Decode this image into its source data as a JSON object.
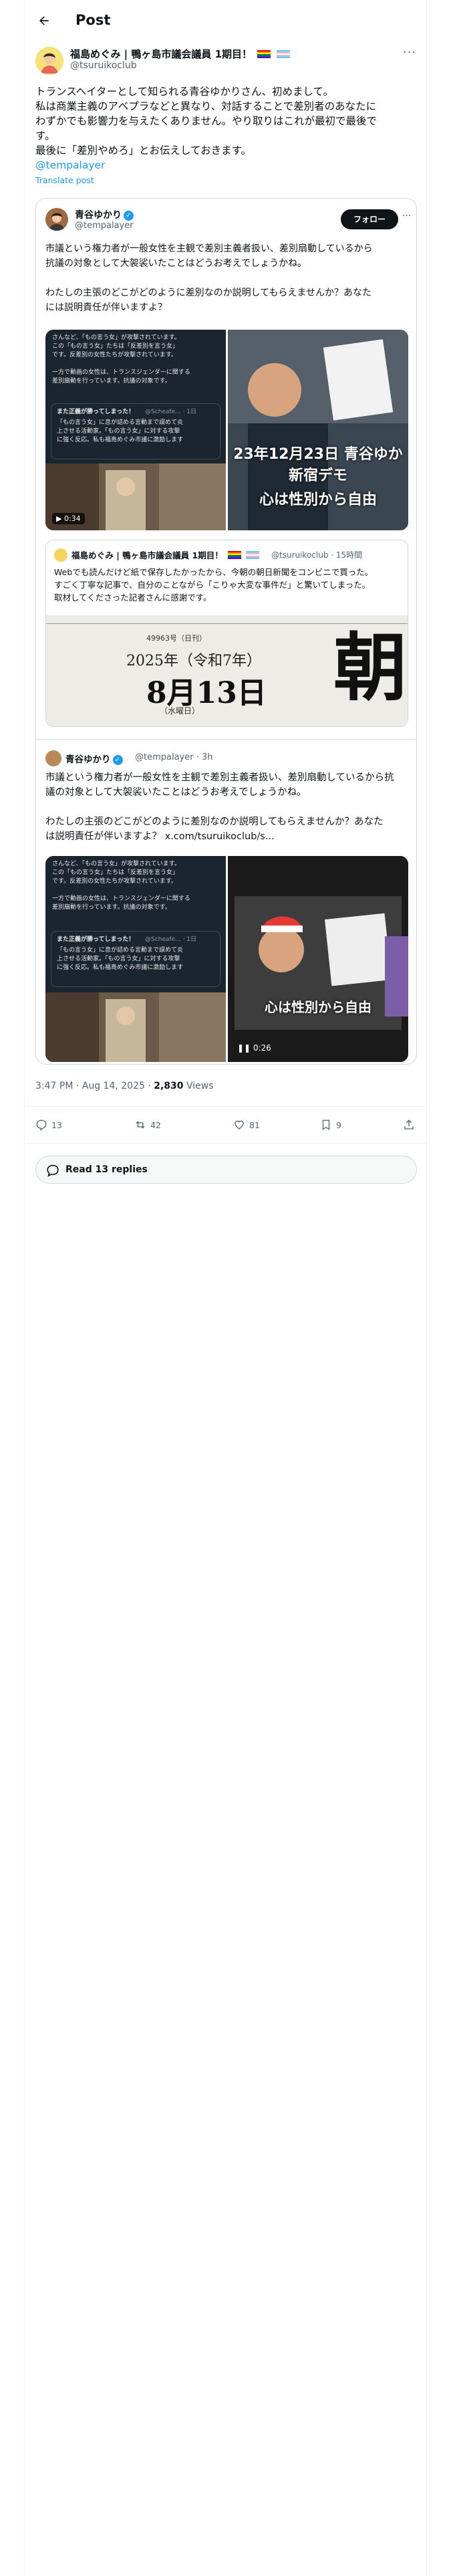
{
  "header": {
    "title": "Post"
  },
  "post": {
    "author_name": "福島めぐみ | 鴨ヶ島市議会議員 1期目！",
    "author_handle": "@tsuruikoclub",
    "text_lines": [
      "トランスヘイターとして知られる青谷ゆかりさん、初めまして。",
      "私は商業主義のアベプラなどと異なり、対話することで差別者のあなたに",
      "わずかでも影響力を与えたくありません。やり取りはこれが最初で最後で",
      "す。",
      "最後に「差別やめろ」とお伝えしておきます。"
    ],
    "mention": "@tempalayer",
    "translate": "Translate post"
  },
  "quote": {
    "author_name": "青谷ゆかり",
    "author_handle": "@tempalayer",
    "follow_label": "フォロー",
    "text_lines": [
      "市議という権力者が一般女性を主観で差別主義者扱い、差別扇動しているから",
      "抗議の対象として大袈裟いたことはどうお考えでしょうかね。",
      "",
      "わたしの主張のどこがどのように差別なのか説明してもらえませんか？あなた",
      "には説明責任が伴いますよ？"
    ],
    "media_left_lines": [
      "さんなど、「もの言う女」が攻撃されています。",
      "この「もの言う女」たちは「反差別を言う女」",
      "です。反差別の女性たちが攻撃されています。",
      "",
      "一方で動画の女性は、トランスジェンダーに関する",
      "差別扇動を行っています。抗議の対象です。"
    ],
    "media_left_snippet_name": "また正義が勝ってしまった！",
    "media_left_snippet_handle": "@Scheafe... · 1日",
    "media_left_snippet_lines": [
      "「もの言う女」に息が詰める言動まで誤めて炎",
      "上させる活動家。「もの言う女」に対する攻撃",
      "に強く反応。私も福島めぐみ市議に激励します"
    ],
    "media_right_caption_1": "23年12月23日 青谷ゆか",
    "media_right_caption_2": "新宿デモ",
    "media_right_caption_3": "心は性別から自由",
    "media_duration": "0:34",
    "inner": {
      "author_name": "福島めぐみ | 鴨ヶ島市議会議員 1期目！",
      "meta": "@tsuruikoclub · 15時間",
      "text_lines": [
        "Webでも読んだけど紙で保存したかったから、今朝の朝日新聞をコンビニで買った。",
        "すごく丁寧な記事で、自分のことながら「こりゃ大変な事件だ」と驚いてしまった。",
        "取材してくださった記者さんに感謝です。"
      ],
      "paper_year": "2025年（令和7年）",
      "paper_date": "8月13日",
      "paper_weekday": "（水曜日）",
      "paper_number": "49963号（日刊）",
      "paper_masthead": "朝"
    },
    "nested": {
      "author_name": "青谷ゆかり",
      "meta": "@tempalayer · 3h",
      "text_lines": [
        "市議という権力者が一般女性を主観で差別主義者扱い、差別扇動しているから抗",
        "議の対象として大袈裟いたことはどうお考えでしょうかね。",
        "",
        "わたしの主張のどこがどのように差別なのか説明してもらえませんか？あなた",
        "は説明責任が伴いますよ？"
      ],
      "link": "x.com/tsuruikoclub/s...",
      "video_caption": "心は性別から自由",
      "video_duration": "0:26"
    }
  },
  "meta": {
    "time": "3:47 PM · Aug 14, 2025 · ",
    "views": "2,830",
    "views_label": " Views"
  },
  "actions": {
    "replies": "13",
    "reposts": "42",
    "likes": "81",
    "bookmarks": "9"
  },
  "read_replies": "Read 13 replies"
}
